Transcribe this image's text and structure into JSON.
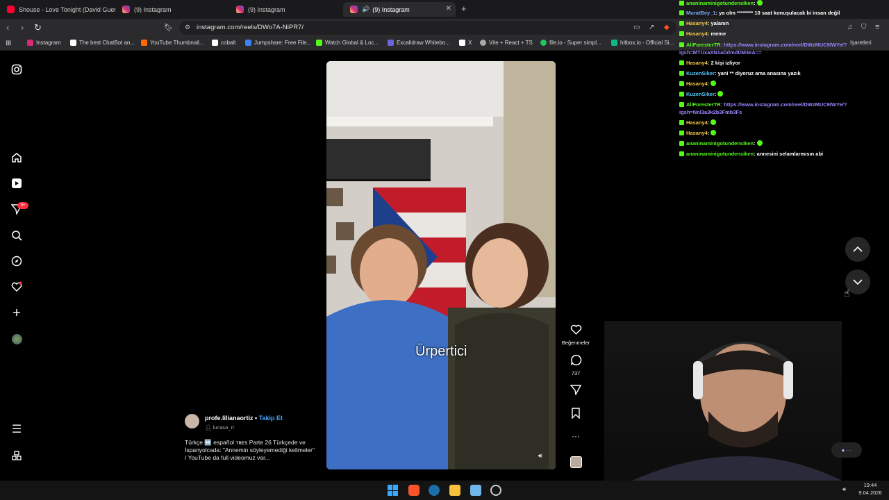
{
  "browser": {
    "tabs": [
      {
        "title": "Shouse - Love Tonight (David Guetta",
        "color": "#ff0033",
        "active": false
      },
      {
        "title": "(9) Instagram",
        "color": "#d62976",
        "active": false
      },
      {
        "title": "(9) Instagram",
        "color": "#d62976",
        "active": false
      },
      {
        "title": "(9) Instagram",
        "color": "#d62976",
        "active": true
      }
    ],
    "address_url": "instagram.com/reels/DWo7A-NiPR7/",
    "bookmarks": [
      {
        "label": "Instagram",
        "color": "#d62976"
      },
      {
        "label": "The best ChatBot an...",
        "color": "#ffffff"
      },
      {
        "label": "YouTube Thumbnail...",
        "color": "#ff6a00"
      },
      {
        "label": "cobalt",
        "color": "#ffffff"
      },
      {
        "label": "Jumpshare: Free File...",
        "color": "#3b82f6"
      },
      {
        "label": "Watch Global & Loc...",
        "color": "#53fc18"
      },
      {
        "label": "Excalidraw Whitebo...",
        "color": "#6965db"
      },
      {
        "label": "X",
        "color": "#ffffff"
      },
      {
        "label": "Vite + React + TS",
        "color": "#aaaaaa"
      },
      {
        "label": "file.io - Super simpl...",
        "color": "#22c55e"
      },
      {
        "label": "hitbox.io - Official Si...",
        "color": "#10b981"
      },
      {
        "label": "İşaretleri",
        "color": "#888888"
      }
    ]
  },
  "instagram": {
    "notification_count": "9+",
    "video_caption": "Ürpertici",
    "author": {
      "username": "profe.lilianaortiz",
      "separator": "•",
      "follow_label": "Takip Et",
      "audio": "lucasa_rr"
    },
    "description": "Türkçe ↔️ español ᴛʀᴇs Parte 26 Türkçede ve İspanyolcada: \"Annemin söyleyemediği kelimeler\" / YouTube da full videomuz var...",
    "like_label": "Beğenmeler",
    "comment_count": "737"
  },
  "chat": {
    "messages": [
      {
        "user": "ananinaminigotundensiken",
        "color": "#53fc18",
        "text": ":"
      },
      {
        "user": "MuratBey_1",
        "color": "#7aa7ff",
        "text": ": ya olm ******** 10 saat konuşulacak bi insan değil"
      },
      {
        "user": "Hasany4",
        "color": "#f5c842",
        "text": ": yalanın"
      },
      {
        "user": "Hasany4",
        "color": "#f5c842",
        "text": ": meme"
      },
      {
        "user": "AliForesterTR",
        "color": "#53fc18",
        "text": ": https://www.instagram.com/reel/DWzMUC9lWYe/?igsh=MTUxaXN1aDdmdDM4eA=="
      },
      {
        "user": "Hasany4",
        "color": "#f5c842",
        "text": ": 2 kişi izliyor"
      },
      {
        "user": "KuzenSiker",
        "color": "#53c8fc",
        "text": ": yani ** diyoruz ama anasına yazık"
      },
      {
        "user": "Hasany4",
        "color": "#f5c842",
        "text": ":"
      },
      {
        "user": "KuzenSiker",
        "color": "#53c8fc",
        "text": ":"
      },
      {
        "user": "AliForesterTR",
        "color": "#53fc18",
        "text": ": https://www.instagram.com/reel/DWzMUC9lWYe/?igsh=Nnl3a3k2b3Fmb3Fs"
      },
      {
        "user": "Hasany4",
        "color": "#f5c842",
        "text": ":"
      },
      {
        "user": "Hasany4",
        "color": "#f5c842",
        "text": ":"
      },
      {
        "user": "ananinaminigotundensiken",
        "color": "#53fc18",
        "text": ":"
      },
      {
        "user": "ananinaminigotundensiken",
        "color": "#53fc18",
        "text": ": annesini selamlarmısın abi"
      }
    ]
  },
  "taskbar": {
    "time": "19:44",
    "date": "9.04.2026"
  }
}
